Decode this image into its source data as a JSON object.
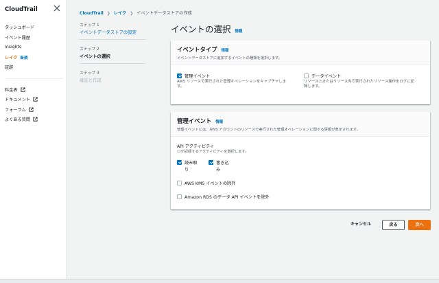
{
  "sidebar": {
    "title": "CloudTrail",
    "items": [
      {
        "label": "ダッシュボード"
      },
      {
        "label": "イベント履歴"
      },
      {
        "label": "Insights"
      },
      {
        "label": "レイク",
        "badge": "新規"
      },
      {
        "label": "証跡"
      }
    ],
    "links": [
      {
        "label": "料金表"
      },
      {
        "label": "ドキュメント"
      },
      {
        "label": "フォーラム"
      },
      {
        "label": "よくある質問"
      }
    ]
  },
  "breadcrumb": {
    "items": [
      "CloudTrail",
      "レイク"
    ],
    "current": "イベントデータストアの作成"
  },
  "steps": [
    {
      "number": "ステップ 1",
      "title": "イベントデータストアの設定"
    },
    {
      "number": "ステップ 2",
      "title": "イベントの選択"
    },
    {
      "number": "ステップ 3",
      "title": "確認と作成"
    }
  ],
  "main": {
    "title": "イベントの選択",
    "info": "情報"
  },
  "event_type_panel": {
    "title": "イベントタイプ",
    "info": "情報",
    "description": "イベントデータストアに追加するイベントの種類を選択します。",
    "options": [
      {
        "label": "管理イベント",
        "checked": true,
        "desc1": "AWS リソースで実行された管理オペレーションをキャプチャしま",
        "desc2": "す。"
      },
      {
        "label": "データイベント",
        "checked": false,
        "desc1": "リソース上またはリソース内で実行されたリソース操作をログに記",
        "desc2": "録します。"
      }
    ]
  },
  "mgmt_panel": {
    "title": "管理イベント",
    "info": "情報",
    "description": "管理イベントには、AWS アカウントのリソースで実行された管理オペレーションに関する情報が表示されます。",
    "api_label": "API アクティビティ",
    "api_desc": "ログ記録するアクティビティを選択します。",
    "read_label_1": "読み取",
    "read_label_2": "り",
    "write_label_1": "書き込",
    "write_label_2": "み",
    "read_checked": true,
    "write_checked": true,
    "kms_label": "AWS KMS イベントの除外",
    "rds_label": "Amazon RDS のデータ API イベントを除外"
  },
  "buttons": {
    "cancel": "キャンセル",
    "back": "戻る",
    "next": "次へ"
  },
  "colors": {
    "accent": "#ec7211",
    "link": "#0073bb"
  }
}
